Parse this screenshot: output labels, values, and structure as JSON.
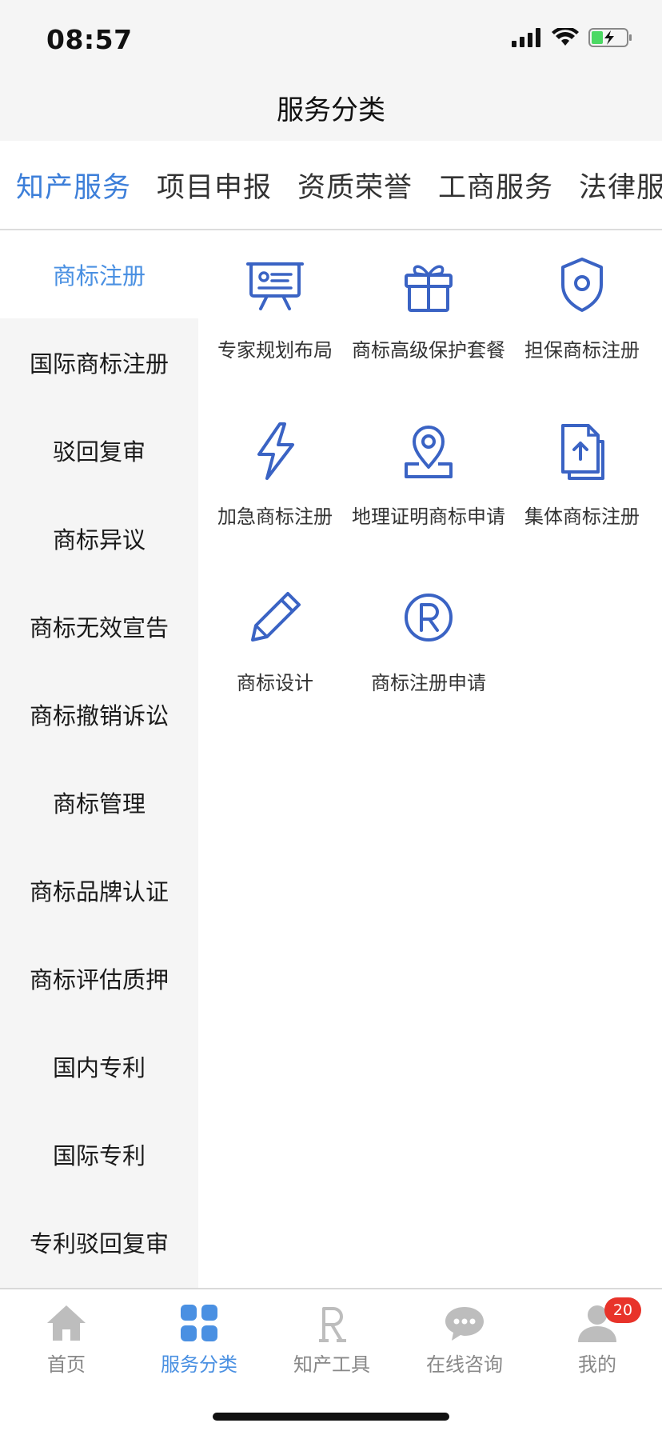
{
  "status_bar": {
    "time": "08:57"
  },
  "header": {
    "title": "服务分类"
  },
  "top_tabs": [
    {
      "label": "知产服务",
      "active": true
    },
    {
      "label": "项目申报",
      "active": false
    },
    {
      "label": "资质荣誉",
      "active": false
    },
    {
      "label": "工商服务",
      "active": false
    },
    {
      "label": "法律服",
      "active": false
    }
  ],
  "sidebar": {
    "items": [
      {
        "label": "商标注册",
        "active": true
      },
      {
        "label": "国际商标注册"
      },
      {
        "label": "驳回复审"
      },
      {
        "label": "商标异议"
      },
      {
        "label": "商标无效宣告"
      },
      {
        "label": "商标撤销诉讼"
      },
      {
        "label": "商标管理"
      },
      {
        "label": "商标品牌认证"
      },
      {
        "label": "商标评估质押"
      },
      {
        "label": "国内专利"
      },
      {
        "label": "国际专利"
      },
      {
        "label": "专利驳回复审"
      }
    ]
  },
  "services": [
    {
      "label": "专家规划布局",
      "icon": "presentation-board-icon"
    },
    {
      "label": "商标高级保护套餐",
      "icon": "gift-icon"
    },
    {
      "label": "担保商标注册",
      "icon": "shield-icon"
    },
    {
      "label": "加急商标注册",
      "icon": "lightning-icon"
    },
    {
      "label": "地理证明商标申请",
      "icon": "location-pin-icon"
    },
    {
      "label": "集体商标注册",
      "icon": "document-upload-icon"
    },
    {
      "label": "商标设计",
      "icon": "pencil-icon"
    },
    {
      "label": "商标注册申请",
      "icon": "registered-mark-icon"
    }
  ],
  "tabbar": {
    "items": [
      {
        "label": "首页",
        "icon": "home-icon"
      },
      {
        "label": "服务分类",
        "icon": "grid-icon",
        "active": true
      },
      {
        "label": "知产工具",
        "icon": "r-letter-icon"
      },
      {
        "label": "在线咨询",
        "icon": "chat-bubble-icon"
      },
      {
        "label": "我的",
        "icon": "user-icon",
        "badge": "20"
      }
    ]
  },
  "colors": {
    "accent": "#4a90e2",
    "icon_blue": "#3a63c4",
    "badge_red": "#e8332a",
    "inactive_gray": "#bdbdbd"
  }
}
